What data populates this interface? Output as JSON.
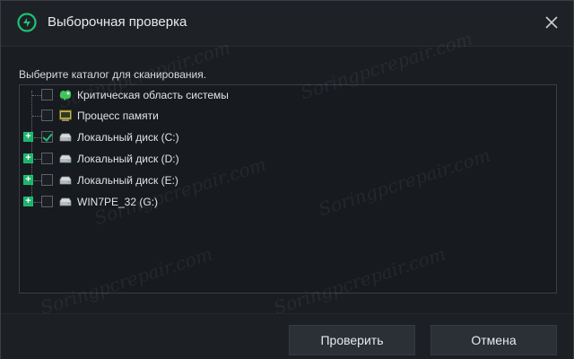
{
  "window": {
    "title": "Выборочная проверка"
  },
  "prompt": "Выберите каталог для сканирования.",
  "tree": [
    {
      "label": "Критическая область системы",
      "checked": false,
      "expandable": false,
      "icon": "system-area-icon"
    },
    {
      "label": "Процесс памяти",
      "checked": false,
      "expandable": false,
      "icon": "memory-process-icon"
    },
    {
      "label": "Локальный диск (C:)",
      "checked": true,
      "expandable": true,
      "icon": "drive-icon"
    },
    {
      "label": "Локальный диск (D:)",
      "checked": false,
      "expandable": true,
      "icon": "drive-icon"
    },
    {
      "label": "Локальный диск (E:)",
      "checked": false,
      "expandable": true,
      "icon": "drive-icon"
    },
    {
      "label": "WIN7PE_32 (G:)",
      "checked": false,
      "expandable": true,
      "icon": "drive-icon"
    }
  ],
  "buttons": {
    "scan": "Проверить",
    "cancel": "Отмена"
  },
  "watermark": "Soringpcrepair.com",
  "colors": {
    "accent": "#1ec176",
    "background": "#1a1d22",
    "button": "#2b3037"
  }
}
